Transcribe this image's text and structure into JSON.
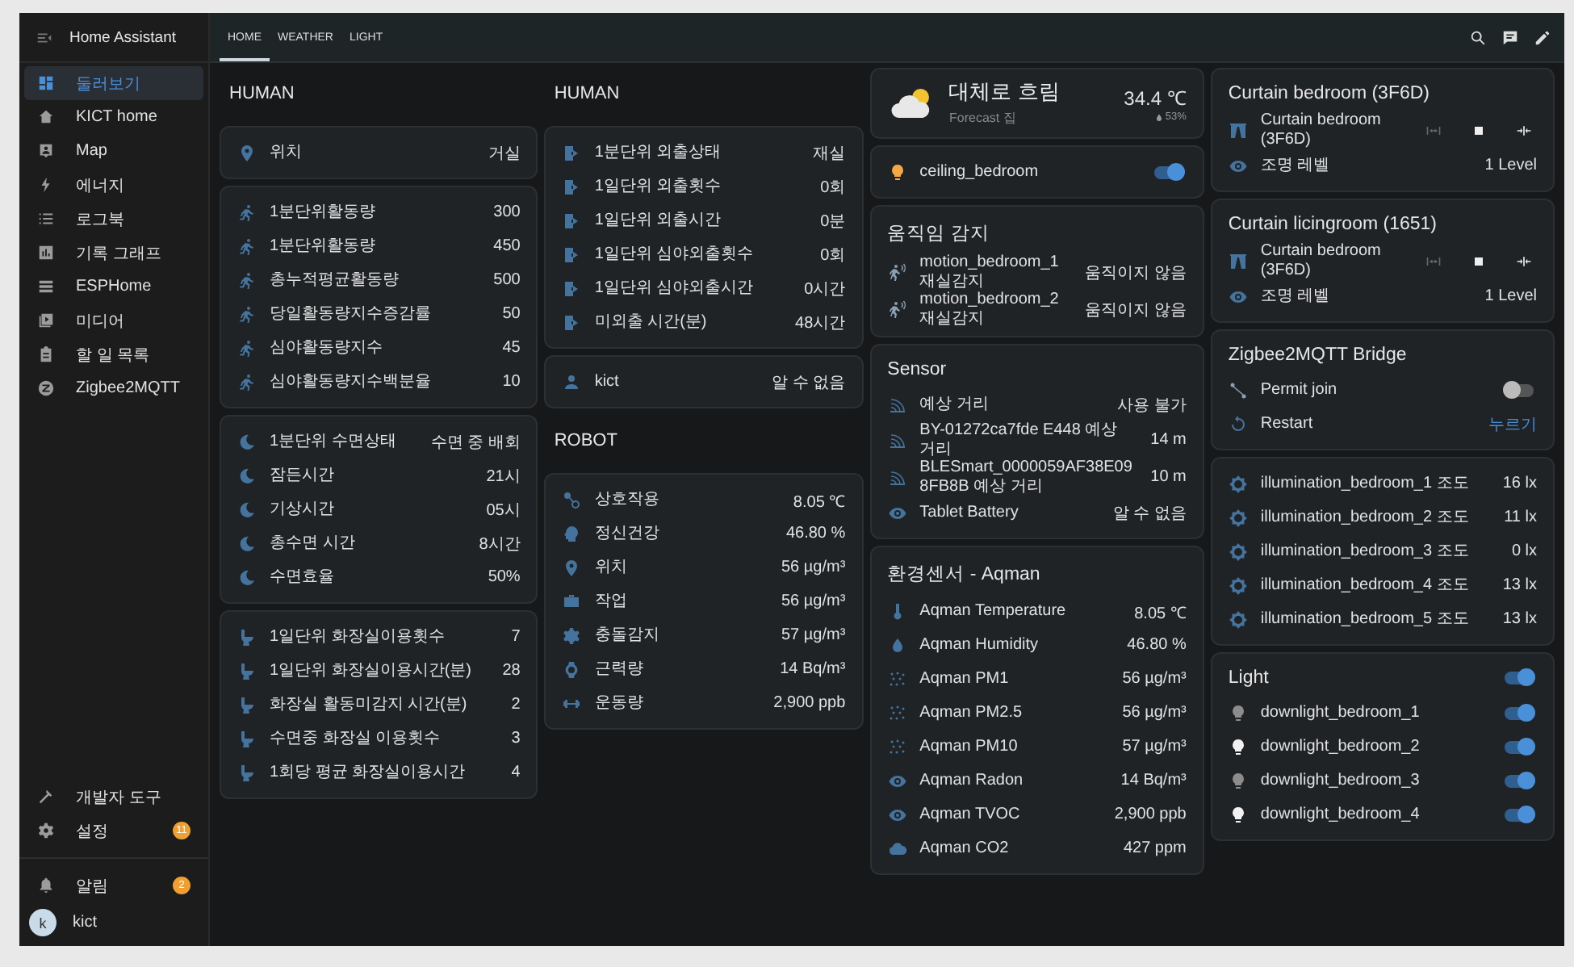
{
  "sidebar": {
    "title": "Home Assistant",
    "items": [
      {
        "label": "둘러보기",
        "selected": true
      },
      {
        "label": "KICT home",
        "selected": false
      },
      {
        "label": "Map",
        "selected": false
      },
      {
        "label": "에너지",
        "selected": false
      },
      {
        "label": "로그북",
        "selected": false
      },
      {
        "label": "기록 그래프",
        "selected": false
      },
      {
        "label": "ESPHome",
        "selected": false
      },
      {
        "label": "미디어",
        "selected": false
      },
      {
        "label": "할 일 목록",
        "selected": false
      },
      {
        "label": "Zigbee2MQTT",
        "selected": false
      }
    ],
    "bottom": [
      {
        "label": "개발자 도구"
      },
      {
        "label": "설정",
        "badge": "11"
      }
    ],
    "notifications": {
      "label": "알림",
      "badge": "2"
    },
    "user": {
      "initial": "k",
      "name": "kict"
    }
  },
  "tabs": [
    {
      "label": "HOME",
      "selected": true
    },
    {
      "label": "WEATHER",
      "selected": false
    },
    {
      "label": "LIGHT",
      "selected": false
    }
  ],
  "columns": [
    {
      "items": [
        {
          "kind": "heading",
          "title": "HUMAN"
        },
        {
          "kind": "entities",
          "rows": [
            {
              "kind": "sensor",
              "name": "위치",
              "value": "거실"
            }
          ]
        },
        {
          "kind": "entities",
          "rows": [
            {
              "kind": "sensor",
              "name": "1분단위활동량",
              "value": "300"
            },
            {
              "kind": "sensor",
              "name": "1분단위활동량",
              "value": "450"
            },
            {
              "kind": "sensor",
              "name": "총누적평균활동량",
              "value": "500"
            },
            {
              "kind": "sensor",
              "name": "당일활동량지수증감률",
              "value": "50"
            },
            {
              "kind": "sensor",
              "name": "심야활동량지수",
              "value": "45"
            },
            {
              "kind": "sensor",
              "name": "심야활동량지수백분율",
              "value": "10"
            }
          ]
        },
        {
          "kind": "entities",
          "rows": [
            {
              "kind": "sensor",
              "name": "1분단위 수면상태",
              "value": "수면 중 배회"
            },
            {
              "kind": "sensor",
              "name": "잠든시간",
              "value": "21시"
            },
            {
              "kind": "sensor",
              "name": "기상시간",
              "value": "05시"
            },
            {
              "kind": "sensor",
              "name": "총수면 시간",
              "value": "8시간"
            },
            {
              "kind": "sensor",
              "name": "수면효율",
              "value": "50%"
            }
          ]
        },
        {
          "kind": "entities",
          "rows": [
            {
              "kind": "sensor",
              "name": "1일단위 화장실이용횟수",
              "value": "7"
            },
            {
              "kind": "sensor",
              "name": "1일단위 화장실이용시간(분)",
              "value": "28"
            },
            {
              "kind": "sensor",
              "name": "화장실 활동미감지 시간(분)",
              "value": "2"
            },
            {
              "kind": "sensor",
              "name": "수면중 화장실 이용횟수",
              "value": "3"
            },
            {
              "kind": "sensor",
              "name": "1회당 평균 화장실이용시간",
              "value": "4"
            }
          ]
        }
      ]
    },
    {
      "items": [
        {
          "kind": "heading",
          "title": "HUMAN"
        },
        {
          "kind": "entities",
          "rows": [
            {
              "kind": "sensor",
              "name": "1분단위 외출상태",
              "value": "재실"
            },
            {
              "kind": "sensor",
              "name": "1일단위 외출횟수",
              "value": "0회"
            },
            {
              "kind": "sensor",
              "name": "1일단위 외출시간",
              "value": "0분"
            },
            {
              "kind": "sensor",
              "name": "1일단위 심야외출횟수",
              "value": "0회"
            },
            {
              "kind": "sensor",
              "name": "1일단위 심야외출시간",
              "value": "0시간"
            },
            {
              "kind": "sensor",
              "name": "미외출 시간(분)",
              "value": "48시간"
            }
          ]
        },
        {
          "kind": "entities",
          "rows": [
            {
              "kind": "sensor",
              "name": "kict",
              "value": "알 수 없음"
            }
          ]
        },
        {
          "kind": "heading",
          "title": "ROBOT"
        },
        {
          "kind": "entities",
          "rows": [
            {
              "kind": "sensor",
              "name": "상호작용",
              "value": "8.05 ℃"
            },
            {
              "kind": "sensor",
              "name": "정신건강",
              "value": "46.80 %"
            },
            {
              "kind": "sensor",
              "name": "위치",
              "value": "56 µg/m³"
            },
            {
              "kind": "sensor",
              "name": "작업",
              "value": "56 µg/m³"
            },
            {
              "kind": "sensor",
              "name": "충돌감지",
              "value": "57 µg/m³"
            },
            {
              "kind": "sensor",
              "name": "근력량",
              "value": "14 Bq/m³"
            },
            {
              "kind": "sensor",
              "name": "운동량",
              "value": "2,900 ppb"
            }
          ]
        }
      ]
    },
    {
      "items": [
        {
          "kind": "weather",
          "condition": "대체로 흐림",
          "source": "Forecast 집",
          "temperature": "34.4 ℃",
          "humidity": "53%"
        },
        {
          "kind": "entities",
          "rows": [
            {
              "kind": "toggle",
              "name": "ceiling_bedroom",
              "on": true
            }
          ]
        },
        {
          "kind": "entities",
          "title": "움직임 감지",
          "rows": [
            {
              "kind": "sensor",
              "name": "motion_bedroom_1 재실감지",
              "value": "움직이지 않음"
            },
            {
              "kind": "sensor",
              "name": "motion_bedroom_2 재실감지",
              "value": "움직이지 않음"
            }
          ]
        },
        {
          "kind": "entities",
          "title": "Sensor",
          "rows": [
            {
              "kind": "sensor",
              "name": "예상 거리",
              "value": "사용 불가"
            },
            {
              "kind": "sensor",
              "name": "BY-01272ca7fde E448 예상 거리",
              "value": "14 m"
            },
            {
              "kind": "sensor",
              "name": "BLESmart_0000059AF38E098FB8B 예상 거리",
              "value": "10 m"
            },
            {
              "kind": "sensor",
              "name": "Tablet Battery",
              "value": "알 수 없음"
            }
          ]
        },
        {
          "kind": "entities",
          "title": "환경센서 - Aqman",
          "rows": [
            {
              "kind": "sensor",
              "name": "Aqman Temperature",
              "value": "8.05 ℃"
            },
            {
              "kind": "sensor",
              "name": "Aqman Humidity",
              "value": "46.80 %"
            },
            {
              "kind": "sensor",
              "name": "Aqman PM1",
              "value": "56 µg/m³"
            },
            {
              "kind": "sensor",
              "name": "Aqman PM2.5",
              "value": "56 µg/m³"
            },
            {
              "kind": "sensor",
              "name": "Aqman PM10",
              "value": "57 µg/m³"
            },
            {
              "kind": "sensor",
              "name": "Aqman Radon",
              "value": "14 Bq/m³"
            },
            {
              "kind": "sensor",
              "name": "Aqman TVOC",
              "value": "2,900 ppb"
            },
            {
              "kind": "sensor",
              "name": "Aqman CO2",
              "value": "427 ppm"
            }
          ]
        }
      ]
    },
    {
      "items": [
        {
          "kind": "entities",
          "title": "Curtain bedroom (3F6D)",
          "rows": [
            {
              "kind": "cover",
              "name": "Curtain bedroom (3F6D)"
            },
            {
              "kind": "sensor",
              "name": "조명 레벨",
              "value": "1 Level"
            }
          ]
        },
        {
          "kind": "entities",
          "title": "Curtain licingroom (1651)",
          "rows": [
            {
              "kind": "cover",
              "name": "Curtain bedroom (3F6D)"
            },
            {
              "kind": "sensor",
              "name": "조명 레벨",
              "value": "1 Level"
            }
          ]
        },
        {
          "kind": "entities",
          "title": "Zigbee2MQTT Bridge",
          "rows": [
            {
              "kind": "toggle",
              "name": "Permit join",
              "on": false
            },
            {
              "kind": "button",
              "name": "Restart",
              "action": "누르기"
            }
          ]
        },
        {
          "kind": "entities",
          "rows": [
            {
              "kind": "sensor",
              "name": "illumination_bedroom_1 조도",
              "value": "16 lx"
            },
            {
              "kind": "sensor",
              "name": "illumination_bedroom_2 조도",
              "value": "11 lx"
            },
            {
              "kind": "sensor",
              "name": "illumination_bedroom_3 조도",
              "value": "0 lx"
            },
            {
              "kind": "sensor",
              "name": "illumination_bedroom_4 조도",
              "value": "13 lx"
            },
            {
              "kind": "sensor",
              "name": "illumination_bedroom_5 조도",
              "value": "13 lx"
            }
          ]
        },
        {
          "kind": "entities",
          "title": "Light",
          "on": true,
          "rows": [
            {
              "kind": "toggle",
              "name": "downlight_bedroom_1",
              "on": true
            },
            {
              "kind": "toggle",
              "name": "downlight_bedroom_2",
              "on": true
            },
            {
              "kind": "toggle",
              "name": "downlight_bedroom_3",
              "on": true
            },
            {
              "kind": "toggle",
              "name": "downlight_bedroom_4",
              "on": true
            }
          ]
        }
      ]
    }
  ]
}
